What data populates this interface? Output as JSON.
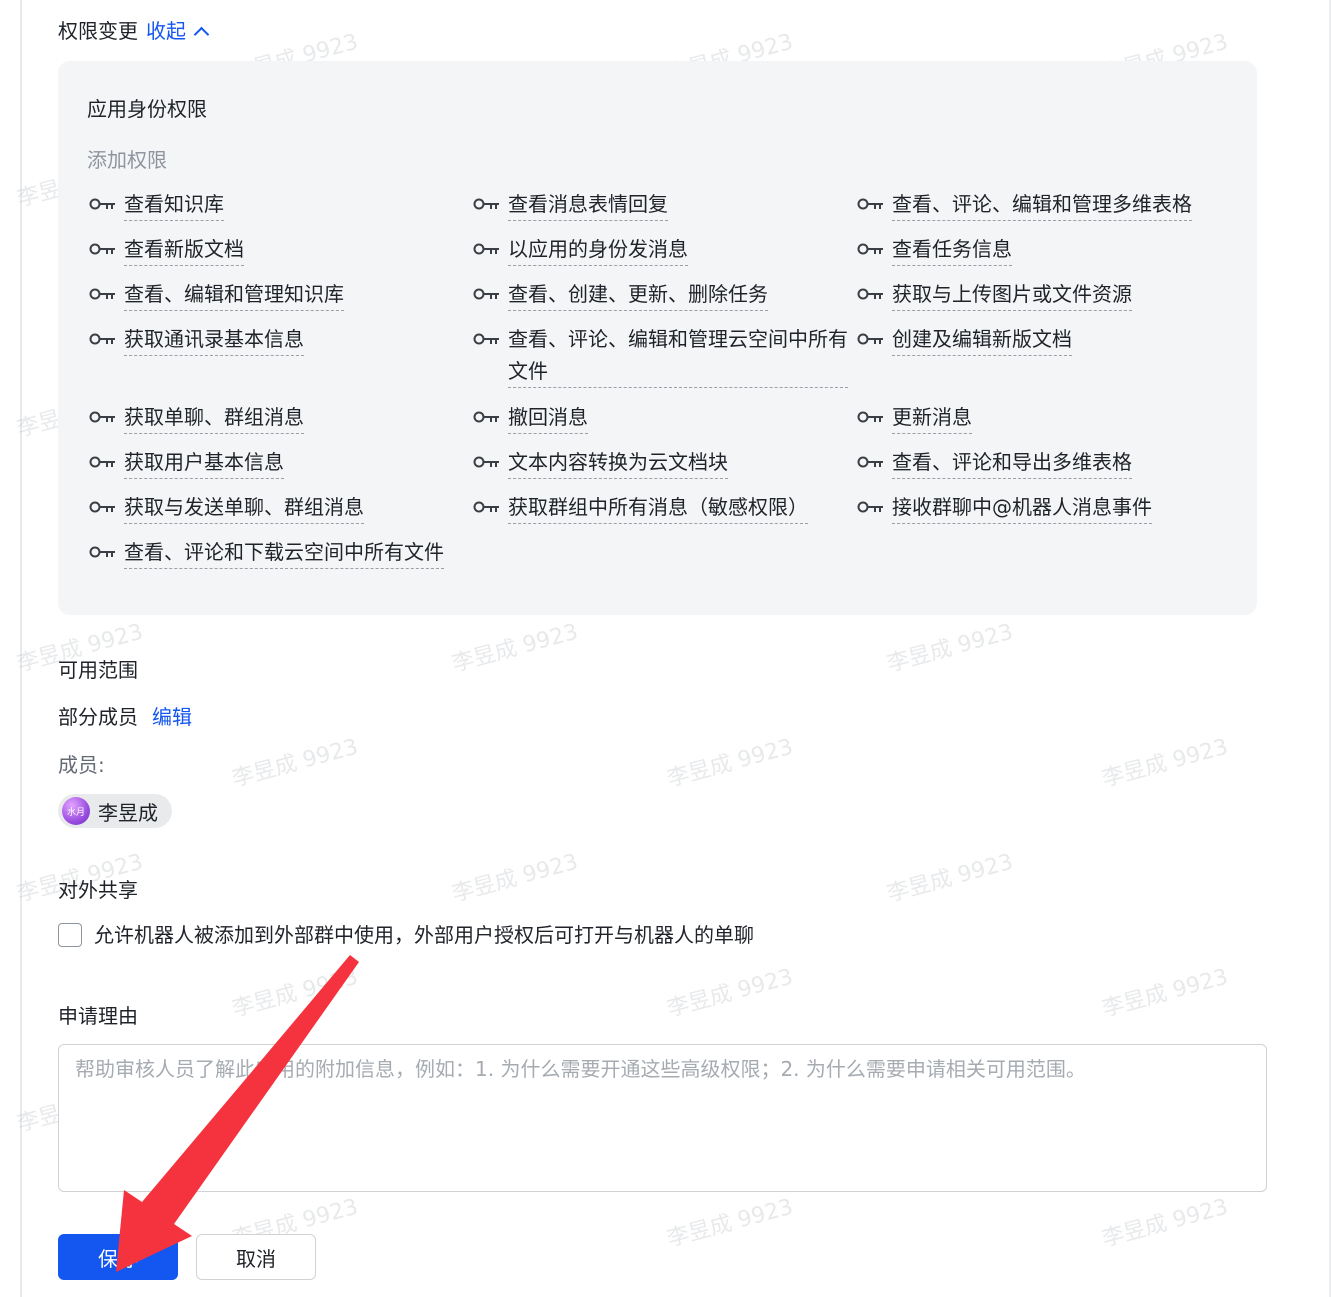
{
  "header": {
    "title": "权限变更",
    "collapse_label": "收起"
  },
  "permissions_panel": {
    "title": "应用身份权限",
    "subtitle": "添加权限",
    "items": [
      "查看知识库",
      "查看消息表情回复",
      "查看、评论、编辑和管理多维表格",
      "查看新版文档",
      "以应用的身份发消息",
      "查看任务信息",
      "查看、编辑和管理知识库",
      "查看、创建、更新、删除任务",
      "获取与上传图片或文件资源",
      "获取通讯录基本信息",
      "查看、评论、编辑和管理云空间中所有文件",
      "创建及编辑新版文档",
      "获取单聊、群组消息",
      "撤回消息",
      "更新消息",
      "获取用户基本信息",
      "文本内容转换为云文档块",
      "查看、评论和导出多维表格",
      "获取与发送单聊、群组消息",
      "获取群组中所有消息（敏感权限）",
      "接收群聊中@机器人消息事件",
      "查看、评论和下载云空间中所有文件"
    ]
  },
  "scope": {
    "label": "可用范围",
    "value": "部分成员",
    "edit_label": "编辑",
    "members_label": "成员:",
    "members": [
      {
        "avatar_text": "水月",
        "name": "李昱成"
      }
    ]
  },
  "external_share": {
    "label": "对外共享",
    "checkbox_label": "允许机器人被添加到外部群中使用，外部用户授权后可打开与机器人的单聊",
    "checked": false
  },
  "reason": {
    "label": "申请理由",
    "value": "",
    "placeholder": "帮助审核人员了解此应用的附加信息，例如：1. 为什么需要开通这些高级权限；2. 为什么需要申请相关可用范围。"
  },
  "buttons": {
    "save_label": "保存",
    "cancel_label": "取消"
  },
  "watermark": "李昱成 9923",
  "colors": {
    "accent": "#1456f0",
    "panel_bg": "#f4f5f7",
    "annotation_arrow": "#f5333f"
  }
}
